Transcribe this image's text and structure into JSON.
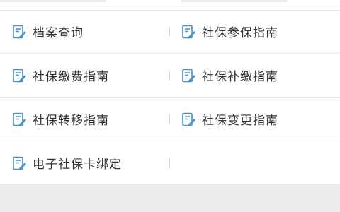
{
  "colors": {
    "icon_accent": "#4a90c8",
    "label_text": "#333333",
    "divider": "#d6d6d6",
    "background": "#ffffff",
    "footer_band": "#ececec"
  },
  "menu": {
    "rows": [
      {
        "left": {
          "label": "档案查询",
          "icon": "document-icon"
        },
        "right": {
          "label": "社保参保指南",
          "icon": "document-icon"
        }
      },
      {
        "left": {
          "label": "社保缴费指南",
          "icon": "document-icon"
        },
        "right": {
          "label": "社保补缴指南",
          "icon": "document-icon"
        }
      },
      {
        "left": {
          "label": "社保转移指南",
          "icon": "document-icon"
        },
        "right": {
          "label": "社保变更指南",
          "icon": "document-icon"
        }
      },
      {
        "left": {
          "label": "电子社保卡绑定",
          "icon": "document-icon"
        },
        "right": null
      }
    ]
  }
}
